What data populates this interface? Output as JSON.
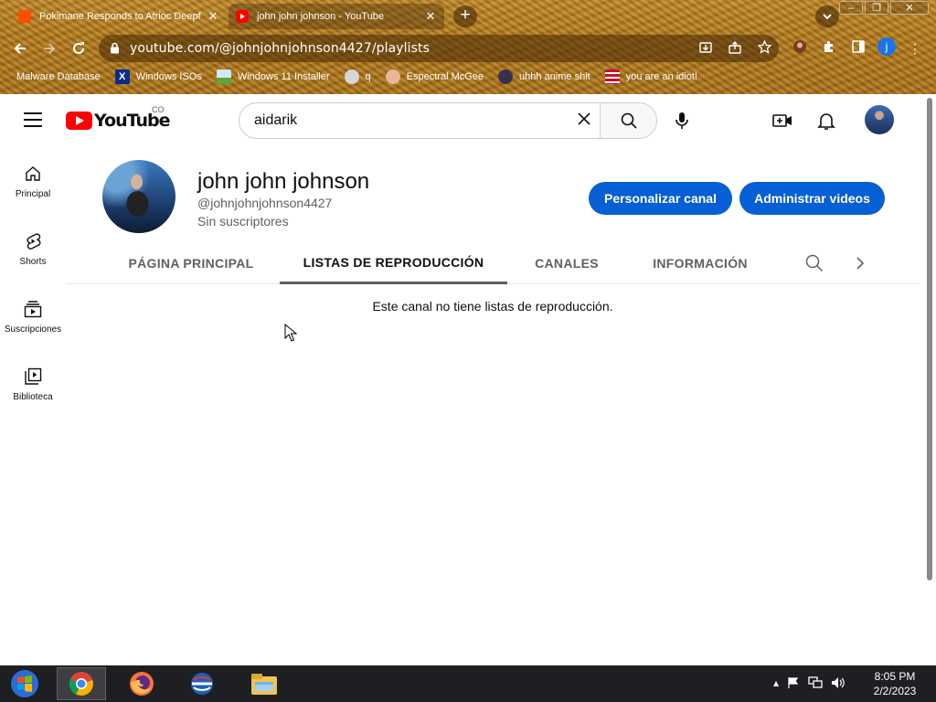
{
  "browser": {
    "tabs": [
      {
        "title": "Pokimane Responds to Atrioc Deepf",
        "favicon_color": "#ff4e00",
        "active": false
      },
      {
        "title": "john john johnson - YouTube",
        "favicon_color": "#ff0000",
        "active": true
      }
    ],
    "close_glyph": "✕",
    "new_tab_glyph": "+",
    "url": "youtube.com/@johnjohnjohnson4427/playlists",
    "profile_initial": "j",
    "bookmarks": [
      {
        "label": "Malware Database",
        "icon": "dot-icon"
      },
      {
        "label": "Windows ISOs",
        "icon": "x-icon"
      },
      {
        "label": "Windows 11 Installer",
        "icon": "image-icon"
      },
      {
        "label": "q",
        "icon": "disk-icon"
      },
      {
        "label": "Espectral McGee",
        "icon": "face-icon"
      },
      {
        "label": "uhhh anime shit",
        "icon": "anime-icon"
      },
      {
        "label": "you are an idiot!",
        "icon": "flag-icon"
      }
    ]
  },
  "youtube": {
    "logo_text": "YouTube",
    "country_code": "CO",
    "search_value": "aidarik",
    "guide": [
      {
        "label": "Principal",
        "icon": "home-icon"
      },
      {
        "label": "Shorts",
        "icon": "shorts-icon"
      },
      {
        "label": "Suscripciones",
        "icon": "subscriptions-icon"
      },
      {
        "label": "Biblioteca",
        "icon": "library-icon"
      }
    ],
    "channel": {
      "name": "john john johnson",
      "handle": "@johnjohnjohnson4427",
      "subscribers": "Sin suscriptores",
      "customize_label": "Personalizar canal",
      "manage_label": "Administrar videos"
    },
    "tabs": [
      {
        "label": "PÁGINA PRINCIPAL",
        "active": false
      },
      {
        "label": "LISTAS DE REPRODUCCIÓN",
        "active": true
      },
      {
        "label": "CANALES",
        "active": false
      },
      {
        "label": "INFORMACIÓN",
        "active": false
      }
    ],
    "empty_message": "Este canal no tiene listas de reproducción."
  },
  "taskbar": {
    "time": "8:05 PM",
    "date": "2/2/2023"
  },
  "colors": {
    "accent_blue": "#065fd4",
    "youtube_red": "#ff0000",
    "taskbar": "#1d1f23"
  }
}
